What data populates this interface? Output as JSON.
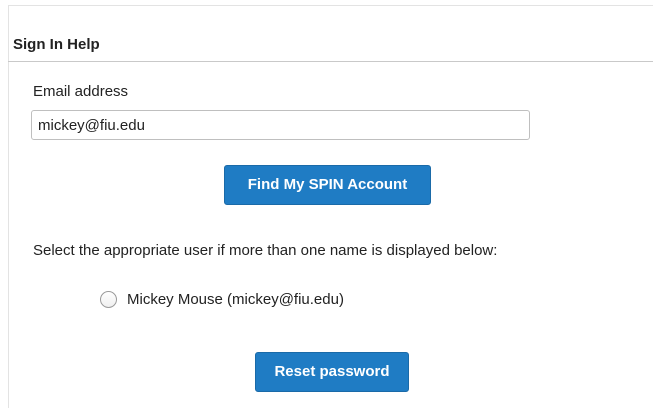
{
  "section": {
    "title": "Sign In Help"
  },
  "form": {
    "email_label": "Email address",
    "email_value": "mickey@fiu.edu",
    "find_button_label": "Find My SPIN Account",
    "instruction": "Select the appropriate user if more than one name is displayed below:",
    "results": [
      {
        "label": "Mickey Mouse (mickey@fiu.edu)",
        "selected": false
      }
    ],
    "reset_button_label": "Reset password"
  },
  "colors": {
    "button_background": "#1f7cc4",
    "button_text": "#ffffff"
  }
}
